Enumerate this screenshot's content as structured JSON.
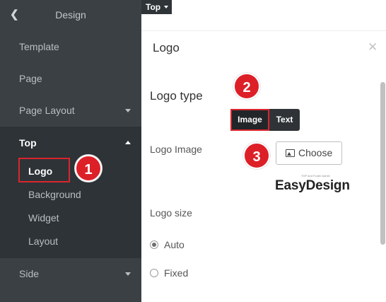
{
  "sidebar": {
    "title": "Design",
    "items": [
      {
        "label": "Template"
      },
      {
        "label": "Page"
      },
      {
        "label": "Page Layout"
      }
    ],
    "active_section": {
      "label": "Top",
      "children": [
        {
          "label": "Logo"
        },
        {
          "label": "Background"
        },
        {
          "label": "Widget"
        },
        {
          "label": "Layout"
        }
      ]
    },
    "after": {
      "label": "Side"
    }
  },
  "top_tab": {
    "label": "Top"
  },
  "panel": {
    "title": "Logo",
    "logo_type_label": "Logo type",
    "segments": {
      "image": "Image",
      "text": "Text",
      "selected": "Image"
    },
    "logo_image_label": "Logo Image",
    "choose_label": "Choose",
    "preview": {
      "brand": "EasyDesign",
      "tagline": "TOP and Footer Admin"
    },
    "logo_size_label": "Logo size",
    "size_options": [
      {
        "label": "Auto",
        "checked": true
      },
      {
        "label": "Fixed",
        "checked": false
      }
    ]
  },
  "annotations": [
    "1",
    "2",
    "3"
  ],
  "colors": {
    "sidebar": "#3b4045",
    "sidebar_active": "#2e3337",
    "accent_red": "#dd2027"
  }
}
